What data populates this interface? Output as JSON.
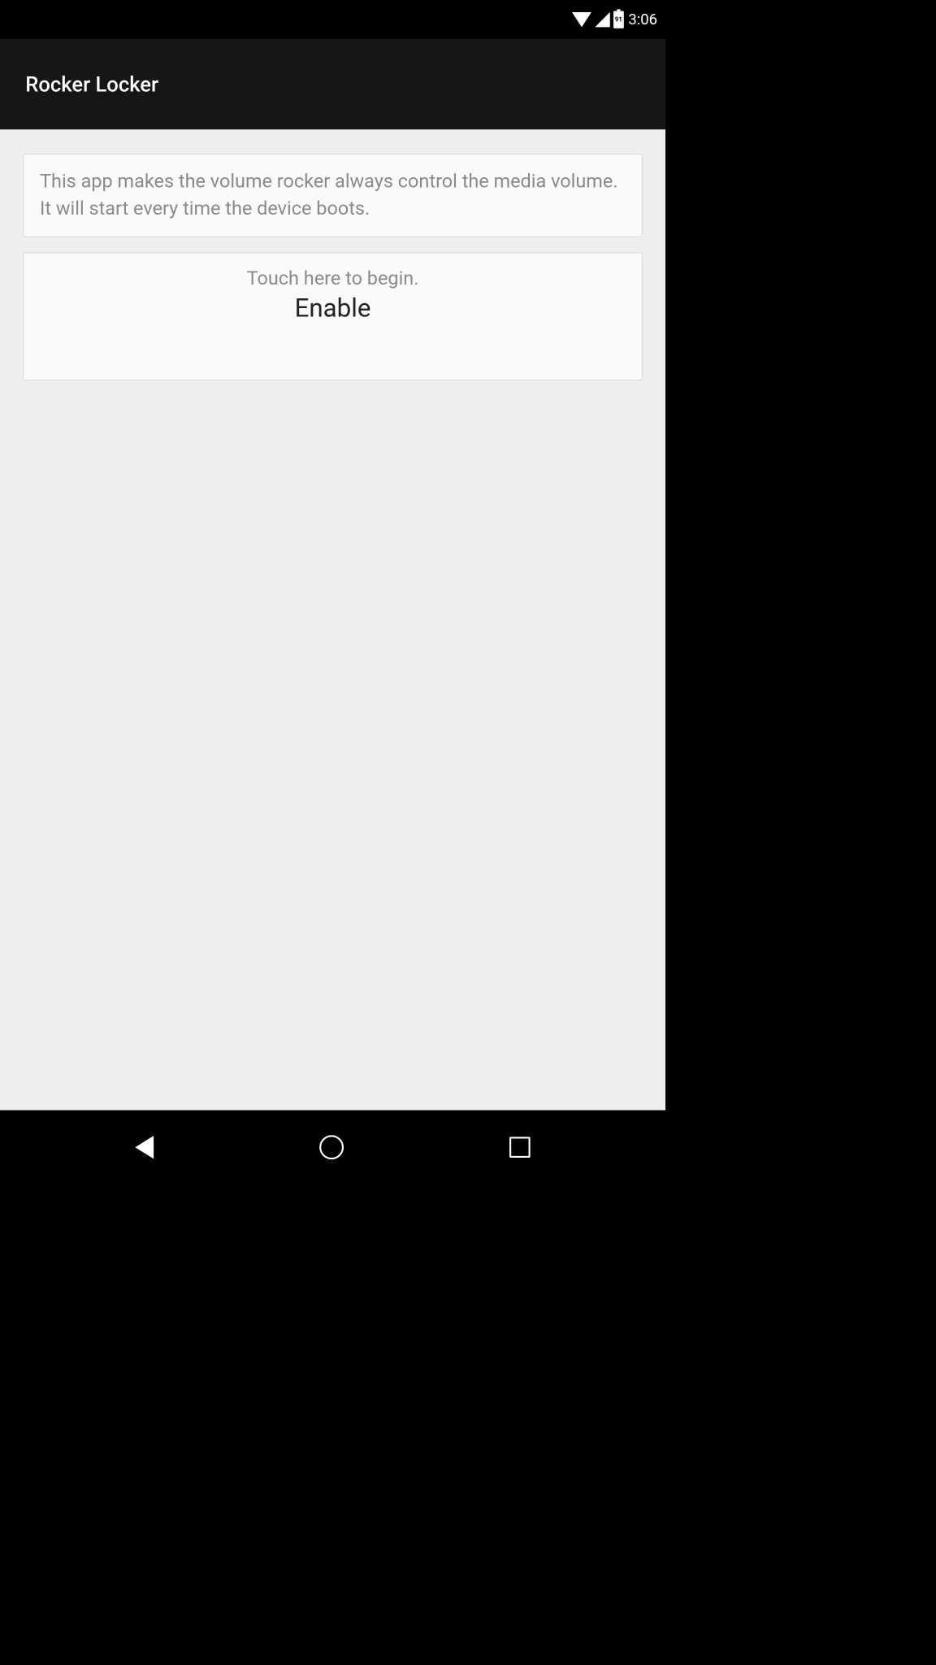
{
  "status_bar": {
    "battery_level": "91",
    "time": "3:06"
  },
  "header": {
    "title": "Rocker Locker"
  },
  "main": {
    "description": "This app makes the volume rocker always control the media volume.  It will start every time the device boots.",
    "touch_hint": "Touch here to begin.",
    "enable_label": "Enable"
  }
}
